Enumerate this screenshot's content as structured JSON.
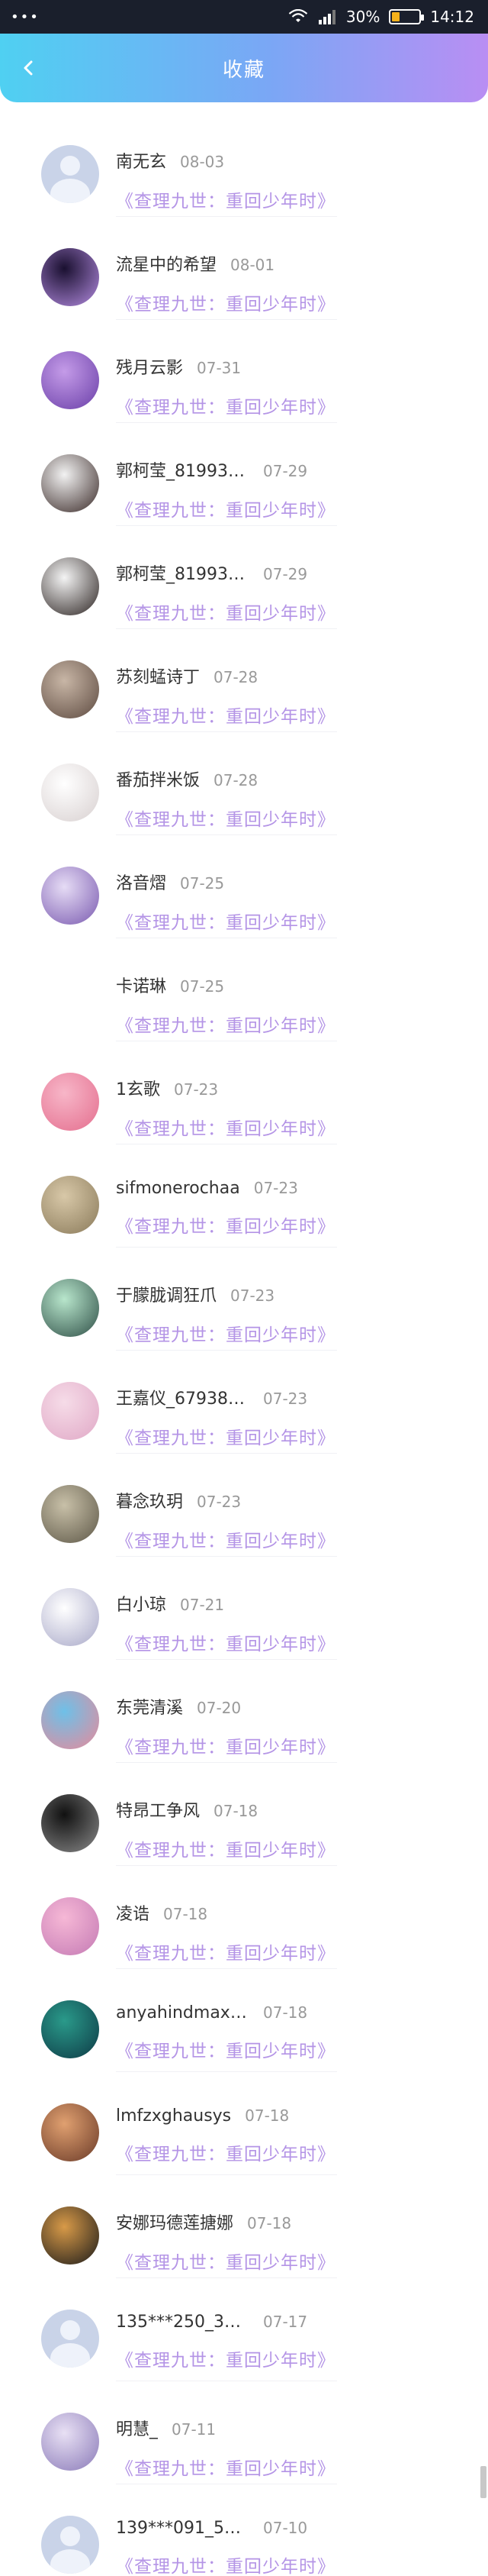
{
  "status_bar": {
    "left": "•••",
    "battery_percent": "30%",
    "battery_level": 0.3,
    "time": "14:12"
  },
  "header": {
    "title": "收藏",
    "back_icon": "chevron-left-icon"
  },
  "colors": {
    "header_gradient_start": "#4fd0f2",
    "header_gradient_end": "#b98ef3",
    "book_title": "#b494e6",
    "date": "#999999",
    "name": "#333333"
  },
  "items": [
    {
      "name": "南无玄",
      "date": "08-03",
      "book": "《查理九世：重回少年时》",
      "avatar": "default",
      "avatar_colors": [
        "#c9d3e8",
        "#c9d3e8"
      ]
    },
    {
      "name": "流星中的希望",
      "date": "08-01",
      "book": "《查理九世：重回少年时》",
      "avatar": "photo",
      "avatar_colors": [
        "#1a1030",
        "#b38be0"
      ]
    },
    {
      "name": "残月云影",
      "date": "07-31",
      "book": "《查理九世：重回少年时》",
      "avatar": "photo",
      "avatar_colors": [
        "#c49be8",
        "#6a3fa8"
      ]
    },
    {
      "name": "郭柯莹_819939...",
      "date": "07-29",
      "book": "《查理九世：重回少年时》",
      "avatar": "photo",
      "avatar_colors": [
        "#f2f2f2",
        "#3a2a28"
      ]
    },
    {
      "name": "郭柯莹_819939...",
      "date": "07-29",
      "book": "《查理九世：重回少年时》",
      "avatar": "photo",
      "avatar_colors": [
        "#f4f4f4",
        "#2c2422"
      ]
    },
    {
      "name": "苏刻蜢诗丁",
      "date": "07-28",
      "book": "《查理九世：重回少年时》",
      "avatar": "photo",
      "avatar_colors": [
        "#c8b6a6",
        "#5d4a40"
      ]
    },
    {
      "name": "番茄拌米饭",
      "date": "07-28",
      "book": "《查理九世：重回少年时》",
      "avatar": "photo",
      "avatar_colors": [
        "#ffffff",
        "#d8d0d0"
      ]
    },
    {
      "name": "洛音熠",
      "date": "07-25",
      "book": "《查理九世：重回少年时》",
      "avatar": "photo",
      "avatar_colors": [
        "#e6dcf5",
        "#7a5ab0"
      ]
    },
    {
      "name": "卡诺琳",
      "date": "07-25",
      "book": "《查理九世：重回少年时》",
      "avatar": "none",
      "avatar_colors": [
        "#ffffff",
        "#ffffff"
      ]
    },
    {
      "name": "1玄歌",
      "date": "07-23",
      "book": "《查理九世：重回少年时》",
      "avatar": "photo",
      "avatar_colors": [
        "#f7b6c8",
        "#e46e8e"
      ]
    },
    {
      "name": "sifmonerochaa",
      "date": "07-23",
      "book": "《查理九世：重回少年时》",
      "avatar": "photo",
      "avatar_colors": [
        "#d8c8a8",
        "#8a7a5a"
      ]
    },
    {
      "name": "于朦胧调狂爪",
      "date": "07-23",
      "book": "《查理九世：重回少年时》",
      "avatar": "photo",
      "avatar_colors": [
        "#b8e6cc",
        "#2e4e46"
      ]
    },
    {
      "name": "王嘉仪_679384...",
      "date": "07-23",
      "book": "《查理九世：重回少年时》",
      "avatar": "photo",
      "avatar_colors": [
        "#f6dce8",
        "#e0a8c6"
      ]
    },
    {
      "name": "暮念玖玥",
      "date": "07-23",
      "book": "《查理九世：重回少年时》",
      "avatar": "photo",
      "avatar_colors": [
        "#c8c0a8",
        "#5e5848"
      ]
    },
    {
      "name": "白小琼",
      "date": "07-21",
      "book": "《查理九世：重回少年时》",
      "avatar": "photo",
      "avatar_colors": [
        "#ffffff",
        "#a8a8c8"
      ]
    },
    {
      "name": "东莞清溪",
      "date": "07-20",
      "book": "《查理九世：重回少年时》",
      "avatar": "photo",
      "avatar_colors": [
        "#6ec0e8",
        "#e88a9a"
      ]
    },
    {
      "name": "特昂工争风",
      "date": "07-18",
      "book": "《查理九世：重回少年时》",
      "avatar": "photo",
      "avatar_colors": [
        "#111111",
        "#8a8a8a"
      ]
    },
    {
      "name": "凌诰",
      "date": "07-18",
      "book": "《查理九世：重回少年时》",
      "avatar": "photo",
      "avatar_colors": [
        "#f6b8d6",
        "#c47ab4"
      ]
    },
    {
      "name": "anyahindmaxra...",
      "date": "07-18",
      "book": "《查理九世：重回少年时》",
      "avatar": "photo",
      "avatar_colors": [
        "#2a9a8a",
        "#0e3a46"
      ]
    },
    {
      "name": "lmfzxghausys",
      "date": "07-18",
      "book": "《查理九世：重回少年时》",
      "avatar": "photo",
      "avatar_colors": [
        "#e0a070",
        "#6a3a28"
      ]
    },
    {
      "name": "安娜玛德莲搪娜",
      "date": "07-18",
      "book": "《查理九世：重回少年时》",
      "avatar": "photo",
      "avatar_colors": [
        "#d89a48",
        "#1a1a1a"
      ]
    },
    {
      "name": "135***250_353...",
      "date": "07-17",
      "book": "《查理九世：重回少年时》",
      "avatar": "default",
      "avatar_colors": [
        "#c9d3e8",
        "#c9d3e8"
      ]
    },
    {
      "name": "明慧_",
      "date": "07-11",
      "book": "《查理九世：重回少年时》",
      "avatar": "photo",
      "avatar_colors": [
        "#e8e0f4",
        "#8a7ab8"
      ]
    },
    {
      "name": "139***091_584...",
      "date": "07-10",
      "book": "《查理九世：重回少年时》",
      "avatar": "default",
      "avatar_colors": [
        "#c9d3e8",
        "#c9d3e8"
      ]
    }
  ]
}
